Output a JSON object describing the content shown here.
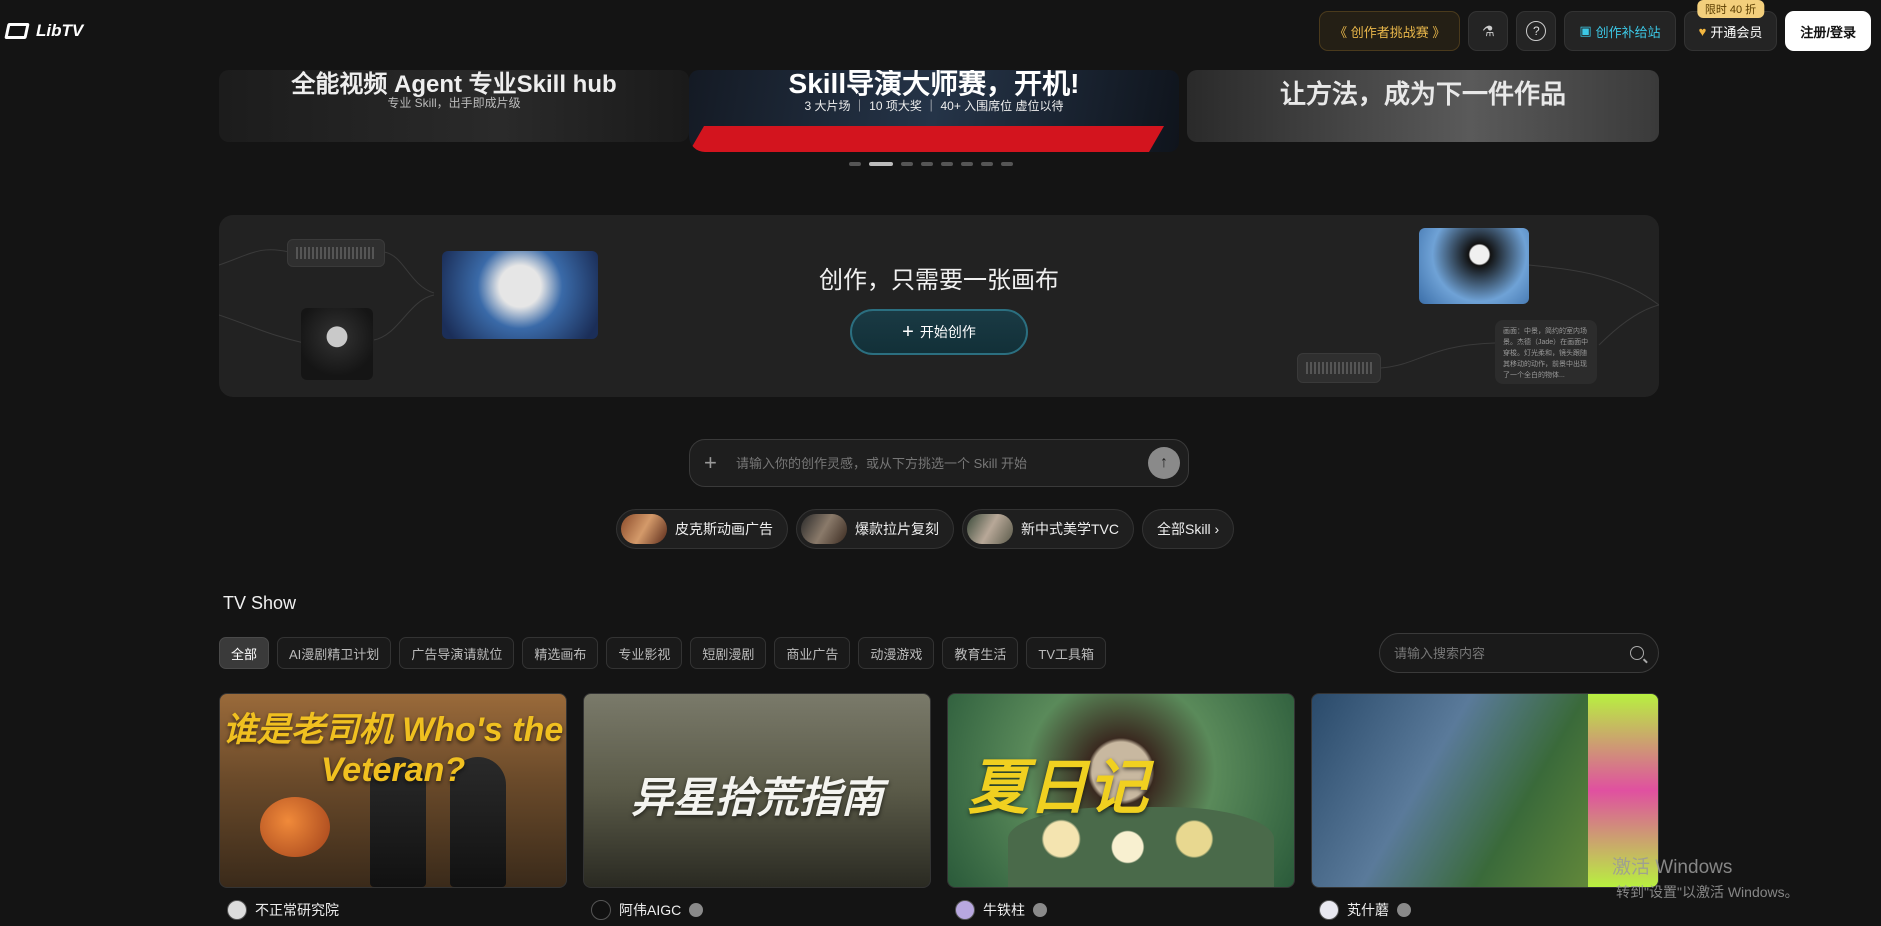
{
  "header": {
    "brand": "LibTV",
    "challenge_label": "《 创作者挑战赛 》",
    "subsidy_label": "创作补给站",
    "vip_label": "开通会员",
    "vip_tag": "限时 40 折",
    "login_label": "注册/登录",
    "icons": [
      "lab-flask-icon",
      "help-icon"
    ]
  },
  "banner": {
    "left_title": "全能视频 Agent 专业Skill hub",
    "left_sub": "专业 Skill，出手即成片级",
    "center_title": "Skill导演大师赛，开机!",
    "center_sub": "3 大片场 ｜ 10 项大奖 ｜ 40+ 入围席位 虚位以待",
    "right_title": "让方法，成为下一件作品",
    "slide_count": 8,
    "active_index": 1
  },
  "canvas": {
    "title": "创作，只需要一张画布",
    "start_label": "开始创作",
    "text_node": "画面：中景，简约的室内场景。杰德（Jade）在画面中穿梭。灯光柔和，镜头跟随其移动的动作，前景中出现了一个全白的物体..."
  },
  "prompt": {
    "placeholder": "请输入你的创作灵感，或从下方挑选一个 Skill 开始"
  },
  "skills": [
    {
      "label": "皮克斯动画广告"
    },
    {
      "label": "爆款拉片复刻"
    },
    {
      "label": "新中式美学TVC"
    }
  ],
  "skills_all_label": "全部Skill ›",
  "tvshow": {
    "title": "TV Show",
    "filters": [
      "全部",
      "AI漫剧精卫计划",
      "广告导演请就位",
      "精选画布",
      "专业影视",
      "短剧漫剧",
      "商业广告",
      "动漫游戏",
      "教育生活",
      "TV工具箱"
    ],
    "search_placeholder": "请输入搜索内容",
    "cards": [
      {
        "caption": "谁是老司机 Who's the Veteran?",
        "author": "不正常研究院"
      },
      {
        "caption": "异星拾荒指南",
        "author": "阿伟AIGC"
      },
      {
        "caption": "夏日记",
        "author": "牛铁柱"
      },
      {
        "caption": "",
        "author": "芄什蘑"
      }
    ]
  },
  "watermark": {
    "line1": "激活 Windows",
    "line2": "转到\"设置\"以激活 Windows。"
  },
  "colors": {
    "background": "#141414",
    "accent_cyan": "#3cc8e6",
    "accent_gold": "#e8b64a",
    "banner_red": "#d3141e"
  }
}
